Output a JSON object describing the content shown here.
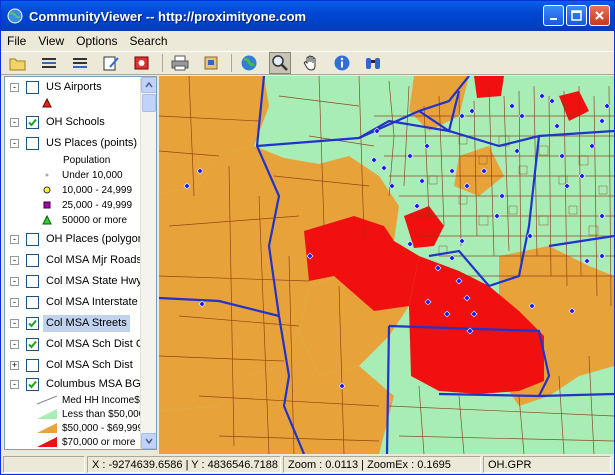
{
  "window": {
    "title": "CommunityViewer -- http://proximityone.com"
  },
  "menu": [
    "File",
    "View",
    "Options",
    "Search"
  ],
  "toolbar": {
    "tools": [
      {
        "name": "open-icon"
      },
      {
        "name": "layers-icon"
      },
      {
        "name": "layer-list-icon"
      },
      {
        "name": "edit-icon"
      },
      {
        "name": "record-icon"
      },
      {
        "name": "print-icon"
      },
      {
        "name": "export-icon"
      },
      {
        "name": "globe-icon"
      },
      {
        "name": "zoom-icon"
      },
      {
        "name": "pan-hand-icon"
      },
      {
        "name": "info-icon"
      },
      {
        "name": "binoculars-icon"
      }
    ]
  },
  "legend": {
    "layers": [
      {
        "label": "US Airports",
        "checked": false,
        "expander": "-"
      },
      {
        "label": "OH Schools",
        "checked": true,
        "expander": "-"
      },
      {
        "label": "US Places (points)",
        "checked": false,
        "expander": "-"
      },
      {
        "label": "OH Places (polygon",
        "checked": false,
        "expander": "-"
      },
      {
        "label": "Col MSA Mjr Roads",
        "checked": false,
        "expander": "-"
      },
      {
        "label": "Col MSA State Hwy",
        "checked": false,
        "expander": "-"
      },
      {
        "label": "Col MSA Interstate",
        "checked": false,
        "expander": "-"
      },
      {
        "label": "Col MSA Streets",
        "checked": true,
        "expander": "-"
      },
      {
        "label": "Col MSA Sch Dist C",
        "checked": true,
        "expander": "-"
      },
      {
        "label": "Col MSA Sch Dist",
        "checked": false,
        "expander": "+"
      },
      {
        "label": "Columbus MSA BG",
        "checked": true,
        "expander": "-"
      }
    ],
    "places_legend": {
      "title": "Population",
      "items": [
        "Under 10,000",
        "10,000 - 24,999",
        "25,000 - 49,999",
        "50000 or more"
      ]
    },
    "bg_legend": {
      "title": "Med HH Income$",
      "items": [
        "Less than $50,000",
        "$50,000 - $69,999",
        "$70,000 or more"
      ]
    }
  },
  "status": {
    "coords": "X : -9274639.6586 | Y : 4836546.7188",
    "zoom": "Zoom : 0.0113 | ZoomEx : 0.1695",
    "file": "OH.GPR"
  },
  "colors": {
    "income_low": "#a8ecb6",
    "income_mid": "#e8a23a",
    "income_high": "#f01010",
    "streets": "#8b3a10",
    "school_district_boundary": "#2233cc",
    "school_marker": "#1a1aff"
  }
}
